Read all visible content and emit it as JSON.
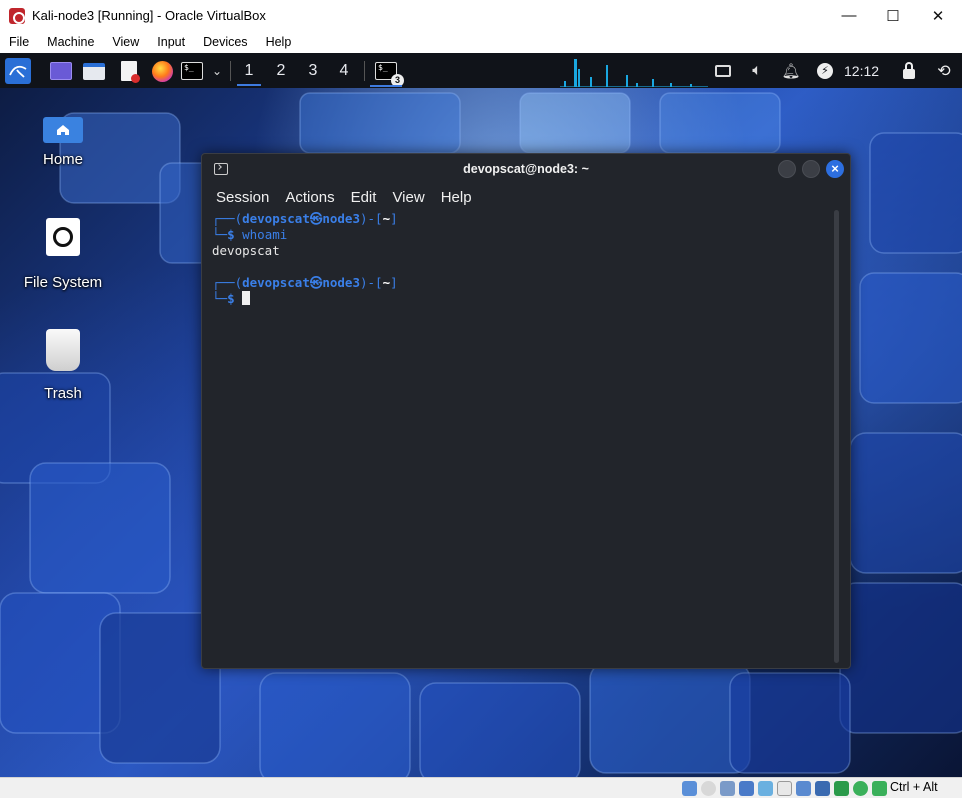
{
  "window": {
    "title": "Kali-node3 [Running] - Oracle VirtualBox",
    "controls": {
      "minimize": "—",
      "maximize": "☐",
      "close": "✕"
    }
  },
  "host_menu": [
    "File",
    "Machine",
    "View",
    "Input",
    "Devices",
    "Help"
  ],
  "panel": {
    "workspaces": [
      "1",
      "2",
      "3",
      "4"
    ],
    "active_workspace": "1",
    "terminal_badge": "3",
    "clock": "12:12"
  },
  "desktop_icons": [
    {
      "label": "Home",
      "icon": "home-folder-icon"
    },
    {
      "label": "File System",
      "icon": "drive-icon"
    },
    {
      "label": "Trash",
      "icon": "trash-icon"
    }
  ],
  "terminal": {
    "title": "devopscat@node3: ~",
    "menu": [
      "Session",
      "Actions",
      "Edit",
      "View",
      "Help"
    ],
    "prompt_user": "devopscat",
    "prompt_at": "㉿",
    "prompt_host": "node3",
    "prompt_dir": "~",
    "command": "whoami",
    "output": "devopscat"
  },
  "statusbar": {
    "host_key": "Ctrl + Alt"
  },
  "colors": {
    "accent": "#3a7fe8",
    "panel": "#101319",
    "terminal_bg": "#22252b",
    "close_button": "#2d6fe0"
  }
}
